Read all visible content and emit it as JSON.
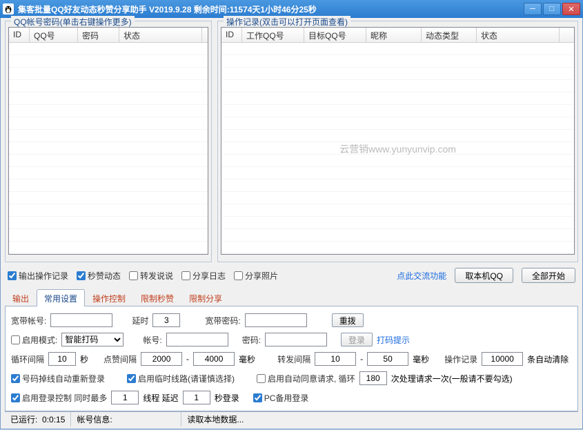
{
  "title": "集客批量QQ好友动态秒赞分享助手 V2019.9.28 剩余时间:11574天1小时46分25秒",
  "groups": {
    "accounts_legend": "QQ帐号密码(单击右键操作更多)",
    "log_legend": "操作记录(双击可以打开页面查看)"
  },
  "accounts_cols": [
    "ID",
    "QQ号",
    "密码",
    "状态"
  ],
  "accounts_col_w": [
    30,
    70,
    60,
    120
  ],
  "log_cols": [
    "ID",
    "工作QQ号",
    "目标QQ号",
    "昵称",
    "动态类型",
    "状态"
  ],
  "log_col_w": [
    30,
    90,
    90,
    80,
    80,
    120
  ],
  "watermark": "云营销www.yunyunvip.com",
  "opts": {
    "out_log": "输出操作记录",
    "like": "秒赞动态",
    "forward": "转发说说",
    "share_log": "分享日志",
    "share_photo": "分享照片",
    "exchange_link": "点此交流功能",
    "get_local_qq": "取本机QQ",
    "start_all": "全部开始"
  },
  "tabs": [
    "输出",
    "常用设置",
    "操作控制",
    "限制秒赞",
    "限制分享"
  ],
  "settings": {
    "bb_acct_label": "宽带帐号:",
    "bb_acct": "",
    "delay_label": "延时",
    "delay": "3",
    "bb_pwd_label": "宽带密码:",
    "bb_pwd": "",
    "redial": "重拨",
    "enable_mode": "启用模式:",
    "mode_sel": "智能打码",
    "acct_label": "帐号:",
    "acct": "",
    "pwd_label": "密码:",
    "pwd": "",
    "login_btn": "登录",
    "code_tip": "打码提示",
    "loop_label": "循环间隔",
    "loop": "10",
    "sec": "秒",
    "like_label": "点赞间隔",
    "like_min": "2000",
    "like_max": "4000",
    "ms": "毫秒",
    "fwd_label": "转发间隔",
    "fwd_min": "10",
    "fwd_max": "50",
    "rec_label": "操作记录",
    "rec": "10000",
    "rec_tail": "条自动清除",
    "relogin": "号码掉线自动重新登录",
    "temp_route": "启用临时线路(请谨慎选择)",
    "auto_agree": "启用自动同意请求, 循环",
    "auto_agree_n": "180",
    "auto_agree_tail": "次处理请求一次(一般请不要勾选)",
    "login_ctrl": "启用登录控制 同时最多",
    "login_n": "1",
    "login_mid": "线程 延迟",
    "login_delay": "1",
    "login_tail": "秒登录",
    "pc_backup": "PC备用登录"
  },
  "status": {
    "run_label": "已运行:",
    "run_time": "0:0:15",
    "acct_info_label": "帐号信息:",
    "reading": "读取本地数据..."
  }
}
